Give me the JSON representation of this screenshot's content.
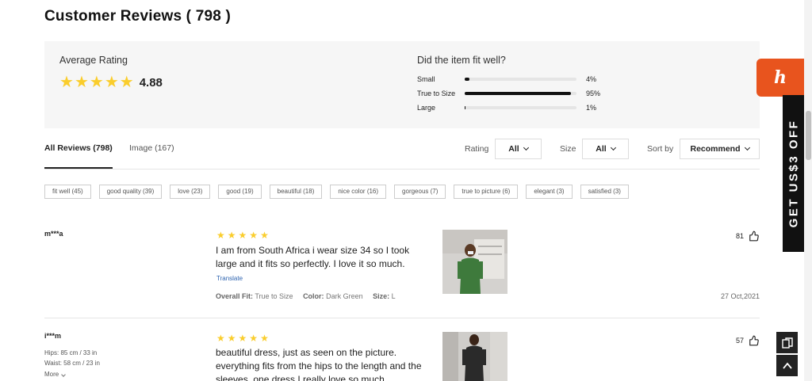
{
  "title": "Customer Reviews ( 798 )",
  "summary": {
    "avg_label": "Average Rating",
    "avg_value": "4.88",
    "avg_stars": "★★★★★",
    "fit_question": "Did the item fit well?",
    "fit": [
      {
        "label": "Small",
        "pct": "4%",
        "value": 0.04
      },
      {
        "label": "True to Size",
        "pct": "95%",
        "value": 0.95
      },
      {
        "label": "Large",
        "pct": "1%",
        "value": 0.01
      }
    ]
  },
  "tabs": {
    "all": "All Reviews (798)",
    "image": "Image (167)"
  },
  "filters": {
    "rating_label": "Rating",
    "rating_value": "All",
    "size_label": "Size",
    "size_value": "All",
    "sort_label": "Sort by",
    "sort_value": "Recommend"
  },
  "chips": [
    "fit well (45)",
    "good quality (39)",
    "love (23)",
    "good (19)",
    "beautiful (18)",
    "nice color (16)",
    "gorgeous (7)",
    "true to picture (6)",
    "elegant (3)",
    "satisfied (3)"
  ],
  "reviews": [
    {
      "user": "m***a",
      "stars": "★★★★★",
      "text": "I am from South Africa i wear size 34 so I took large and it fits so perfectly. I love it so much.",
      "translate": "Translate",
      "fit_label": "Overall Fit:",
      "fit_value": "True to Size",
      "color_label": "Color:",
      "color_value": "Dark Green",
      "size_label": "Size:",
      "size_value": "L",
      "likes": "81",
      "date": "27 Oct,2021"
    },
    {
      "user": "i***m",
      "hips": "Hips: 85 cm / 33 in",
      "waist": "Waist: 58 cm / 23 in",
      "more": "More",
      "stars": "★★★★★",
      "text": "beautiful dress, just as seen on the picture. everything fits from the hips to the length and the sleeves. one dress I really love so much",
      "likes": "57"
    }
  ],
  "promo": {
    "text": "GET US$3 OFF",
    "logo_letter": "h",
    "color": "#e8541e"
  },
  "colors": {
    "star": "#facd2c",
    "accent": "#e8541e",
    "link": "#2f64b0"
  }
}
